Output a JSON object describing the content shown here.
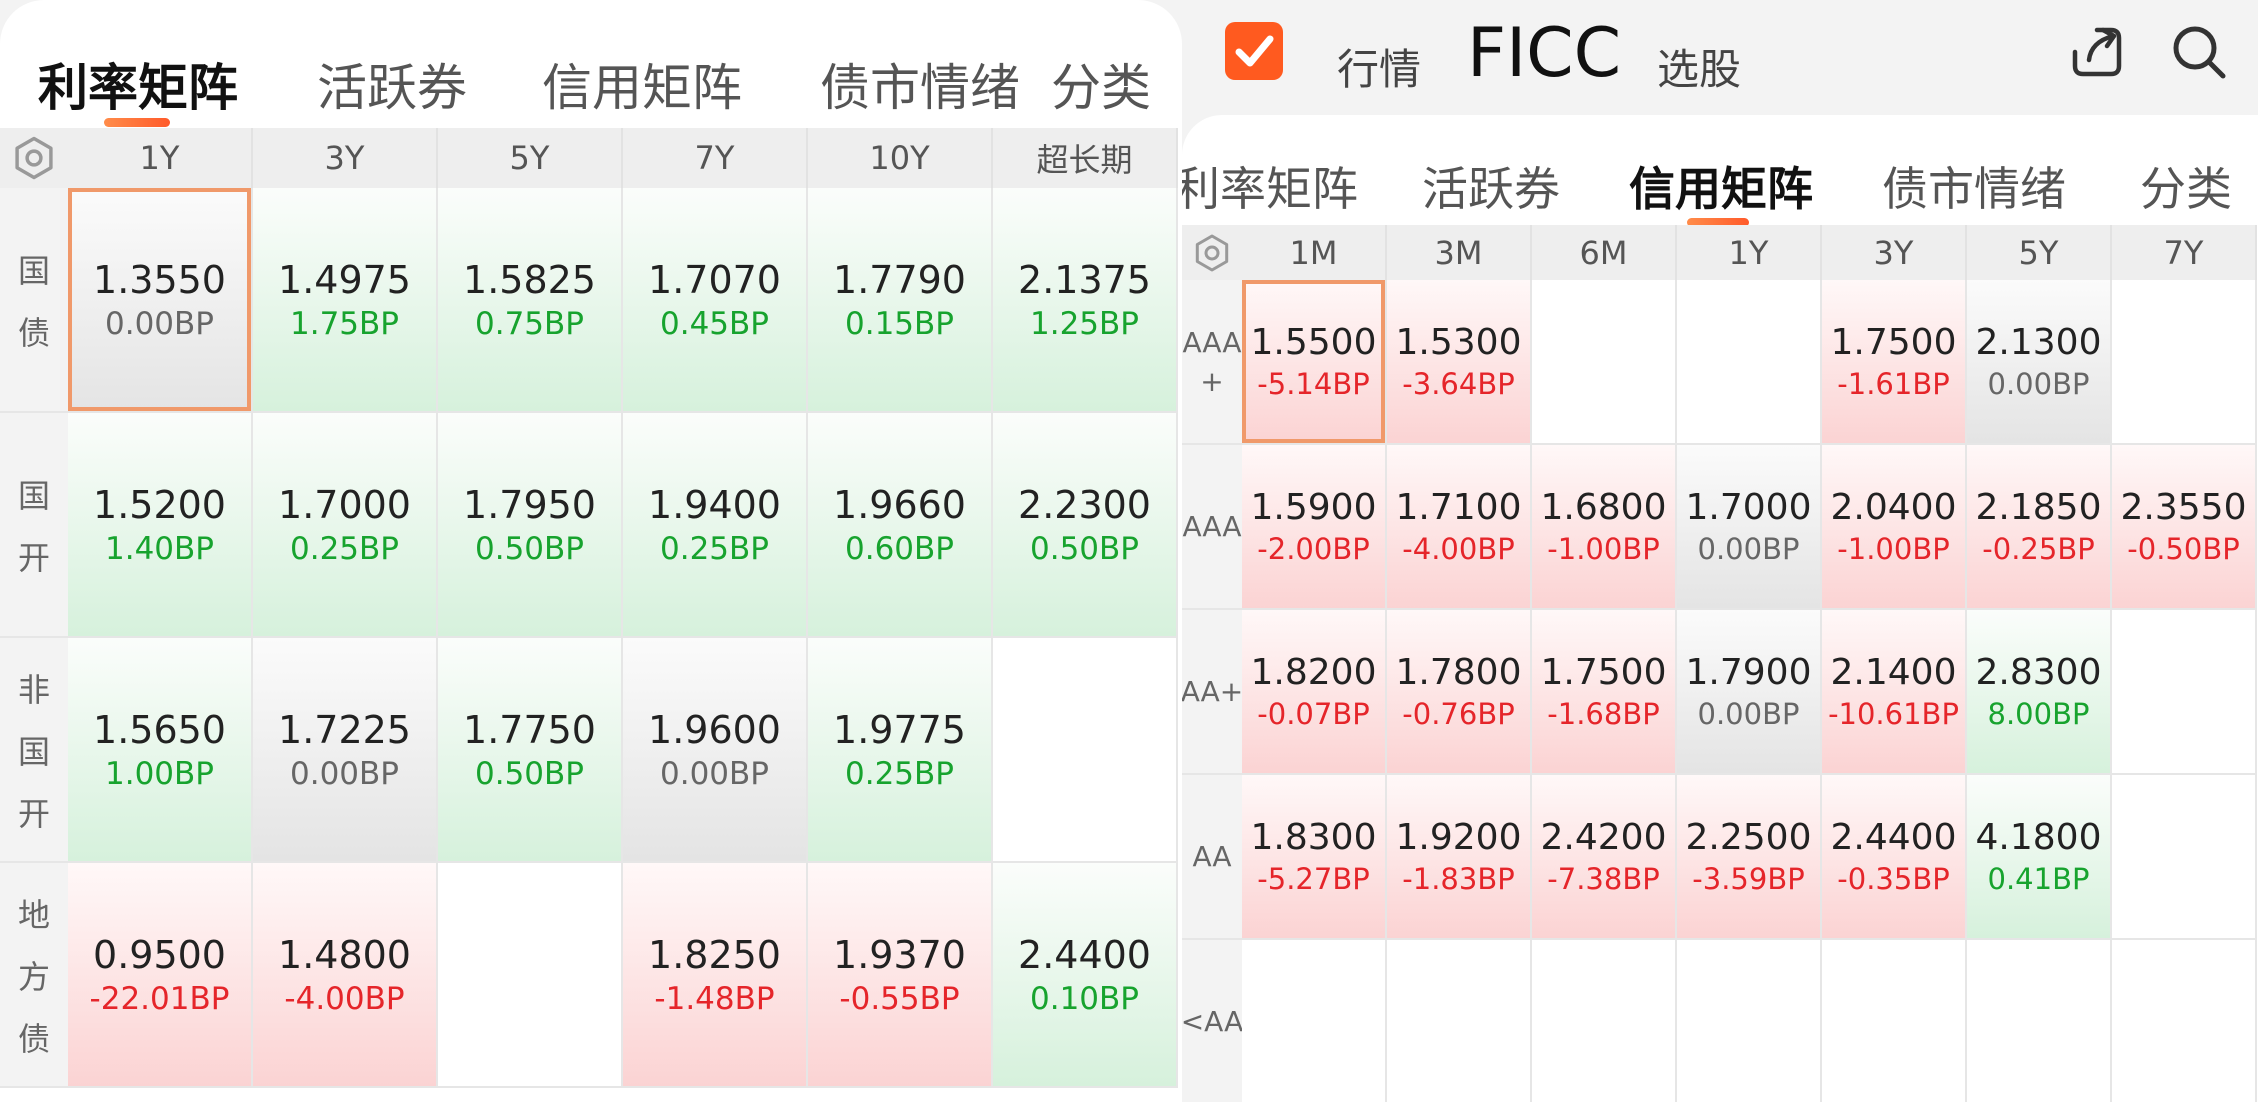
{
  "left": {
    "tabs": [
      "利率矩阵",
      "活跃券",
      "信用矩阵",
      "债市情绪",
      "分类"
    ],
    "active_tab": 0,
    "columns": [
      "1Y",
      "3Y",
      "5Y",
      "7Y",
      "10Y",
      "超长期"
    ],
    "rows": [
      {
        "label": "国\n债",
        "cells": [
          {
            "value": "1.3550",
            "change": "0.00BP",
            "trend": "flat",
            "selected": true
          },
          {
            "value": "1.4975",
            "change": "1.75BP",
            "trend": "up"
          },
          {
            "value": "1.5825",
            "change": "0.75BP",
            "trend": "up"
          },
          {
            "value": "1.7070",
            "change": "0.45BP",
            "trend": "up"
          },
          {
            "value": "1.7790",
            "change": "0.15BP",
            "trend": "up"
          },
          {
            "value": "2.1375",
            "change": "1.25BP",
            "trend": "up"
          }
        ]
      },
      {
        "label": "国\n开",
        "cells": [
          {
            "value": "1.5200",
            "change": "1.40BP",
            "trend": "up"
          },
          {
            "value": "1.7000",
            "change": "0.25BP",
            "trend": "up"
          },
          {
            "value": "1.7950",
            "change": "0.50BP",
            "trend": "up"
          },
          {
            "value": "1.9400",
            "change": "0.25BP",
            "trend": "up"
          },
          {
            "value": "1.9660",
            "change": "0.60BP",
            "trend": "up"
          },
          {
            "value": "2.2300",
            "change": "0.50BP",
            "trend": "up"
          }
        ]
      },
      {
        "label": "非\n国\n开",
        "cells": [
          {
            "value": "1.5650",
            "change": "1.00BP",
            "trend": "up"
          },
          {
            "value": "1.7225",
            "change": "0.00BP",
            "trend": "flat"
          },
          {
            "value": "1.7750",
            "change": "0.50BP",
            "trend": "up"
          },
          {
            "value": "1.9600",
            "change": "0.00BP",
            "trend": "flat"
          },
          {
            "value": "1.9775",
            "change": "0.25BP",
            "trend": "up"
          },
          null
        ]
      },
      {
        "label": "地\n方\n债",
        "cells": [
          {
            "value": "0.9500",
            "change": "-22.01BP",
            "trend": "down"
          },
          {
            "value": "1.4800",
            "change": "-4.00BP",
            "trend": "down"
          },
          null,
          {
            "value": "1.8250",
            "change": "-1.48BP",
            "trend": "down"
          },
          {
            "value": "1.9370",
            "change": "-0.55BP",
            "trend": "down"
          },
          {
            "value": "2.4400",
            "change": "0.10BP",
            "trend": "up"
          }
        ]
      }
    ]
  },
  "right": {
    "nav": {
      "items": [
        "行情",
        "FICC",
        "选股"
      ],
      "active": 1,
      "checkbox_icon": "check-box-icon",
      "share_icon": "share-icon",
      "search_icon": "search-icon"
    },
    "tabs": [
      "利率矩阵",
      "活跃券",
      "信用矩阵",
      "债市情绪",
      "分类"
    ],
    "active_tab": 2,
    "columns": [
      "1M",
      "3M",
      "6M",
      "1Y",
      "3Y",
      "5Y",
      "7Y"
    ],
    "rows": [
      {
        "label": "AAA\n+",
        "cells": [
          {
            "value": "1.5500",
            "change": "-5.14BP",
            "trend": "down",
            "selected": true
          },
          {
            "value": "1.5300",
            "change": "-3.64BP",
            "trend": "down"
          },
          null,
          null,
          {
            "value": "1.7500",
            "change": "-1.61BP",
            "trend": "down"
          },
          {
            "value": "2.1300",
            "change": "0.00BP",
            "trend": "flat"
          },
          null
        ]
      },
      {
        "label": "AAA",
        "cells": [
          {
            "value": "1.5900",
            "change": "-2.00BP",
            "trend": "down"
          },
          {
            "value": "1.7100",
            "change": "-4.00BP",
            "trend": "down"
          },
          {
            "value": "1.6800",
            "change": "-1.00BP",
            "trend": "down"
          },
          {
            "value": "1.7000",
            "change": "0.00BP",
            "trend": "flat"
          },
          {
            "value": "2.0400",
            "change": "-1.00BP",
            "trend": "down"
          },
          {
            "value": "2.1850",
            "change": "-0.25BP",
            "trend": "down"
          },
          {
            "value": "2.3550",
            "change": "-0.50BP",
            "trend": "down"
          }
        ]
      },
      {
        "label": "AA+",
        "cells": [
          {
            "value": "1.8200",
            "change": "-0.07BP",
            "trend": "down"
          },
          {
            "value": "1.7800",
            "change": "-0.76BP",
            "trend": "down"
          },
          {
            "value": "1.7500",
            "change": "-1.68BP",
            "trend": "down"
          },
          {
            "value": "1.7900",
            "change": "0.00BP",
            "trend": "flat"
          },
          {
            "value": "2.1400",
            "change": "-10.61BP",
            "trend": "down"
          },
          {
            "value": "2.8300",
            "change": "8.00BP",
            "trend": "up"
          },
          null
        ]
      },
      {
        "label": "AA",
        "cells": [
          {
            "value": "1.8300",
            "change": "-5.27BP",
            "trend": "down"
          },
          {
            "value": "1.9200",
            "change": "-1.83BP",
            "trend": "down"
          },
          {
            "value": "2.4200",
            "change": "-7.38BP",
            "trend": "down"
          },
          {
            "value": "2.2500",
            "change": "-3.59BP",
            "trend": "down"
          },
          {
            "value": "2.4400",
            "change": "-0.35BP",
            "trend": "down"
          },
          {
            "value": "4.1800",
            "change": "0.41BP",
            "trend": "up"
          },
          null
        ]
      },
      {
        "label": "<AA",
        "cells": [
          null,
          null,
          null,
          null,
          null,
          null,
          null
        ]
      }
    ]
  },
  "colors": {
    "up": "#17a32e",
    "down": "#e5252a",
    "flat": "#666666",
    "accent": "#ff6a30"
  }
}
